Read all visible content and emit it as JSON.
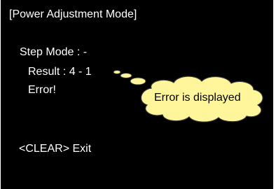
{
  "screen": {
    "title": "[Power Adjustment Mode]",
    "step_mode": "Step Mode : -",
    "result": "Result : 4 - 1",
    "error": "Error!",
    "exit_hint": "<CLEAR> Exit"
  },
  "callout": {
    "text": "Error is displayed",
    "fill_color": "#fff59a",
    "stroke_color": "#333333"
  },
  "colors": {
    "screen_background": "#000000",
    "screen_text": "#ffffff"
  }
}
